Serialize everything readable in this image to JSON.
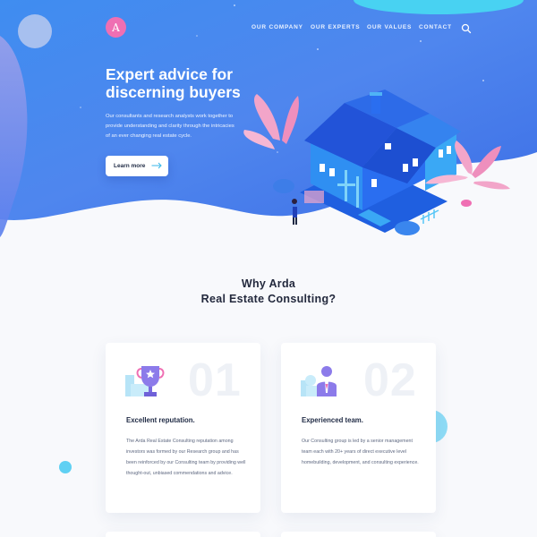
{
  "logo": {
    "letter": "A"
  },
  "nav": {
    "items": [
      {
        "label": "OUR COMPANY"
      },
      {
        "label": "OUR EXPERTS"
      },
      {
        "label": "OUR VALUES"
      },
      {
        "label": "CONTACT"
      }
    ],
    "search_icon": "search-icon"
  },
  "hero": {
    "title_line1": "Expert advice for",
    "title_line2": "discerning buyers",
    "text": "Our consultants and research analysts work together to provide understanding and clarity through the intricacies of an ever changing real estate cycle.",
    "button_label": "Learn more"
  },
  "why": {
    "title_line1": "Why Arda",
    "title_line2": "Real Estate Consulting?"
  },
  "cards": [
    {
      "number": "01",
      "icon": "trophy-icon",
      "title": "Excellent reputation.",
      "text": "The Arda Real Estate Consulting reputation among investors was formed by our Research group and has been reinforced by our Consulting team by providing well thought-out, unbiased commendations and advice."
    },
    {
      "number": "02",
      "icon": "team-icon",
      "title": "Experienced team.",
      "text": "Our Consulting group is led by a senior management team each with 20+ years of direct executive level homebuilding, development, and consulting experience."
    }
  ],
  "colors": {
    "hero_gradient_start": "#4d7cf0",
    "hero_gradient_end": "#2f9ef3",
    "accent_pink": "#ef6fb3",
    "accent_cyan": "#61d3f5"
  }
}
